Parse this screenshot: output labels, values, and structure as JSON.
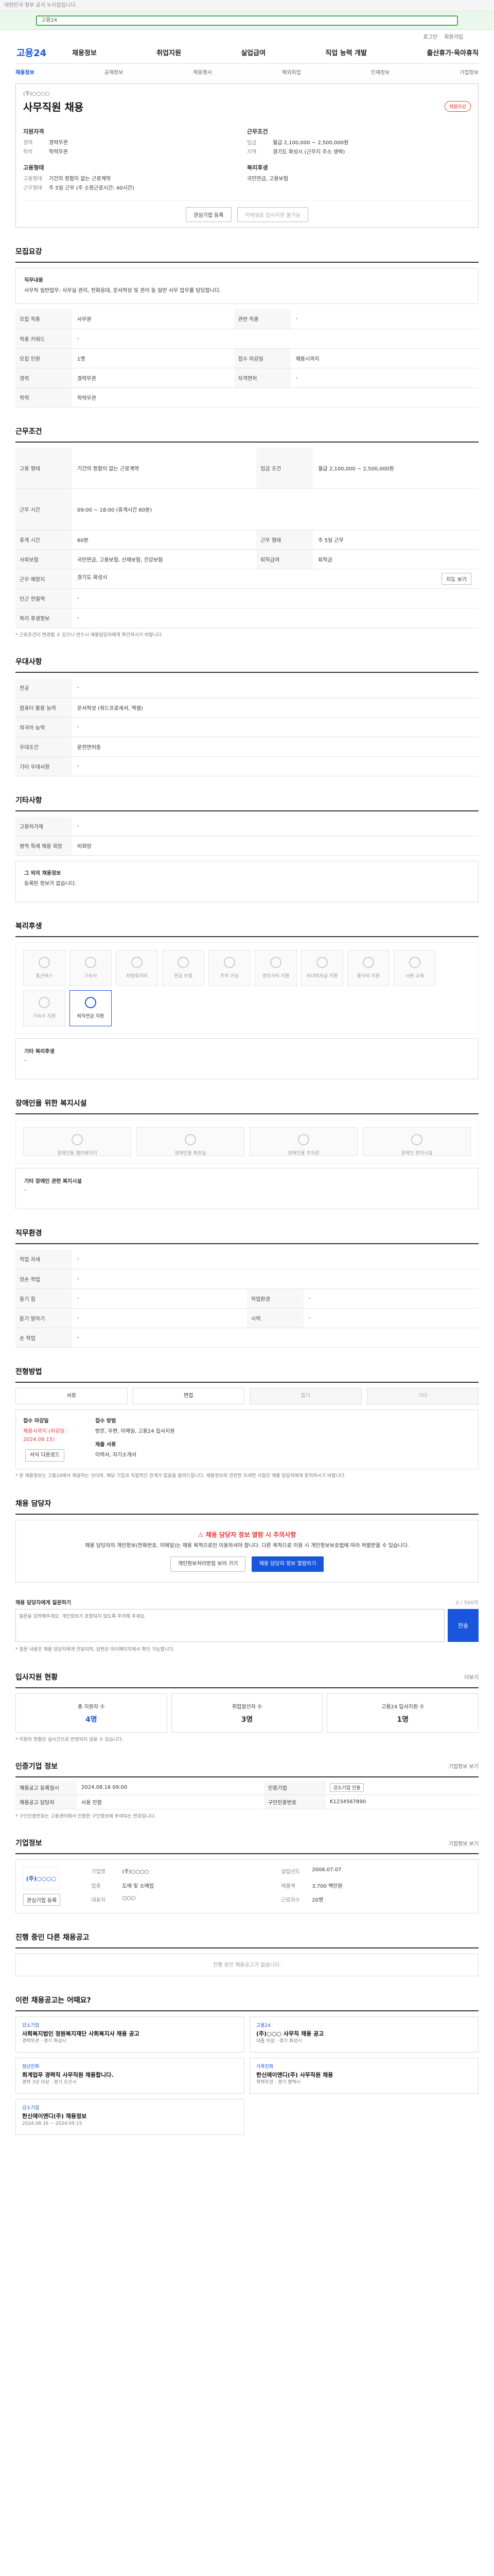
{
  "topbar": {
    "text": "대한민국 정부 공식 누리집입니다."
  },
  "search": {
    "value": "고용24"
  },
  "util": [
    "로그인",
    "회원가입"
  ],
  "gnb": {
    "logo": "고용24",
    "menu": [
      "채용정보",
      "취업지원",
      "실업급여",
      "직업 능력 개발",
      "출산휴가·육아휴직"
    ]
  },
  "snb": [
    "채용정보",
    "공채정보",
    "채용행사",
    "해외취업",
    "인재정보",
    "기업정보"
  ],
  "job": {
    "company": "(주)○○○○",
    "title": "사무직원 채용",
    "badge": "채용마감",
    "left_head": "지원자격",
    "left": [
      {
        "k": "경력",
        "v": "경력무관"
      },
      {
        "k": "학력",
        "v": "학력무관"
      }
    ],
    "left_head2": "고용형태",
    "left2": [
      {
        "k": "고용형태",
        "v": "기간의 정함이 없는 근로계약"
      },
      {
        "k": "근무형태",
        "v": "주 5일 근무 (주 소정근로시간: 40시간)"
      }
    ],
    "right_head": "근무조건",
    "right": [
      {
        "k": "임금",
        "v": "월급 2,100,000 ~ 2,500,000원"
      },
      {
        "k": "지역",
        "v": "경기도 화성시 (근무지 주소 생략)"
      }
    ],
    "right_head2": "복리후생",
    "right2": [
      {
        "k": "",
        "v": "국민연금, 고용보험"
      }
    ],
    "btn1": "관심기업 등록",
    "btn2": "이메일로 입사지원 불가능"
  },
  "s1": {
    "title": "모집요강",
    "content_label": "직무내용",
    "content": "사무직 일반업무: 사무실 관리, 전화응대, 문서작성 및 관리 등 일반 사무 업무를 담당합니다.",
    "rows": [
      {
        "k": "모집 직종",
        "v": "사무원",
        "k2": "관련 직종",
        "v2": "-"
      },
      {
        "k": "직종 키워드",
        "v": "-",
        "k2": "",
        "v2": ""
      },
      {
        "k": "모집 인원",
        "v": "1명",
        "k2": "접수 마감일",
        "v2": "채용시까지"
      },
      {
        "k": "경력",
        "v": "경력무관",
        "k2": "자격면허",
        "v2": "-"
      },
      {
        "k": "학력",
        "v": "학력무관",
        "k2": "",
        "v2": ""
      }
    ]
  },
  "s2": {
    "title": "근무조건",
    "rows": [
      {
        "k": "고용 형태",
        "v": "기간의 정함이 없는 근로계약",
        "k2": "임금 조건",
        "v2": "월급 2,100,000 ~ 2,500,000원"
      },
      {
        "k": "근무 시간",
        "v": "09:00 ~ 18:00 (휴게시간 60분)",
        "k2": "",
        "v2": ""
      },
      {
        "k": "휴게 시간",
        "v": "60분",
        "k2": "근무 형태",
        "v2": "주 5일 근무"
      },
      {
        "k": "사회보험",
        "v": "국민연금, 고용보험, 산재보험, 건강보험",
        "k2": "퇴직급여",
        "v2": "퇴직금"
      },
      {
        "k": "근무 예정지",
        "v": "경기도 화성시",
        "k2": "",
        "v2": ""
      },
      {
        "k": "인근 전철역",
        "v": "-",
        "k2": "",
        "v2": ""
      },
      {
        "k": "복리 후생정보",
        "v": "-",
        "k2": "",
        "v2": ""
      }
    ],
    "map_btn": "지도 보기",
    "note": "* 근로조건이 변경될 수 있으니 반드시 채용담당자에게 확인하시기 바랍니다."
  },
  "s3": {
    "title": "우대사항",
    "rows": [
      {
        "k": "전공",
        "v": "-"
      },
      {
        "k": "컴퓨터 활용 능력",
        "v": "문서작성 (워드프로세서, 엑셀)"
      },
      {
        "k": "외국어 능력",
        "v": "-"
      },
      {
        "k": "우대조건",
        "v": "운전면허증"
      },
      {
        "k": "기타 우대사항",
        "v": "-"
      }
    ]
  },
  "s4": {
    "title": "기타사항",
    "rows": [
      {
        "k": "고용허가제",
        "v": "-"
      },
      {
        "k": "병역 특례 채용 희망",
        "v": "비희망"
      }
    ],
    "extra_label": "그 외의 채용정보",
    "extra": "등록된 정보가 없습니다."
  },
  "s5": {
    "title": "복리후생",
    "items": [
      {
        "label": "통근버스",
        "on": false
      },
      {
        "label": "기숙사",
        "on": false
      },
      {
        "label": "차량유지비",
        "on": false
      },
      {
        "label": "연금 보험",
        "on": false
      },
      {
        "label": "주차 가능",
        "on": false
      },
      {
        "label": "경조사비 지원",
        "on": false
      },
      {
        "label": "자녀학자금 지원",
        "on": false
      },
      {
        "label": "중식비 지원",
        "on": false
      },
      {
        "label": "사원 교육",
        "on": false
      },
      {
        "label": "기숙사 지원",
        "on": false
      },
      {
        "label": "퇴직연금 지원",
        "on": true
      }
    ],
    "other_label": "기타 복리후생",
    "other": "-"
  },
  "s6": {
    "title": "장애인을 위한 복지시설",
    "items": [
      "장애인용 엘리베이터",
      "장애인용 화장실",
      "장애인용 주차장",
      "장애인 편의시설"
    ],
    "other_label": "기타 장애인 관련 복지시설",
    "other": "-"
  },
  "s7": {
    "title": "직무환경",
    "rows": [
      {
        "k": "작업 자세",
        "v": "-",
        "k2": "",
        "v2": ""
      },
      {
        "k": "양손 작업",
        "v": "-",
        "k2": "",
        "v2": ""
      },
      {
        "k": "들기 힘",
        "v": "-",
        "k2": "작업환경",
        "v2": "-"
      },
      {
        "k": "듣기 말하기",
        "v": "-",
        "k2": "시력",
        "v2": "-"
      },
      {
        "k": "손 작업",
        "v": "-",
        "k2": "",
        "v2": ""
      }
    ]
  },
  "s8": {
    "title": "전형방법",
    "steps": [
      {
        "label": "서류",
        "dim": false
      },
      {
        "label": "면접",
        "dim": false
      },
      {
        "label": "필기",
        "dim": true
      },
      {
        "label": "기타",
        "dim": true
      }
    ],
    "apply_label": "접수 마감일",
    "apply": "채용시까지 (마감일 : 2024.09.15)",
    "method_label": "접수 방법",
    "method": "방문, 우편, 이메일, 고용24 입사지원",
    "doc_label": "제출 서류",
    "doc": "이력서, 자기소개서",
    "form_btn": "서식 다운로드",
    "notes": "* 본 채용정보는 고용24에서 제공하는 것이며, 해당 기업과 직접적인 관계가 없음을 알려드립니다. 채용정보와 관련한 자세한 사항은 채용 담당자에게 문의하시기 바랍니다."
  },
  "s9": {
    "title": "채용 담당자",
    "alert": "채용 담당자 정보 열람 시 주의사항",
    "body": "채용 담당자의 개인정보(전화번호, 이메일)는 채용 목적으로만 이용하셔야 합니다. 다른 목적으로 이용 시 개인정보보호법에 따라 처벌받을 수 있습니다.",
    "btn1": "개인정보처리방침 보러 가기",
    "btn2": "채용 담당자 정보 열람하기"
  },
  "qa": {
    "label": "채용 담당자에게 질문하기",
    "count": "0 / 500자",
    "placeholder": "질문을 입력해주세요. 개인정보가 포함되지 않도록 주의해 주세요.",
    "send": "전송",
    "notes": "* 질문 내용은 채용 담당자에게 전달되며, 답변은 마이페이지에서 확인 가능합니다."
  },
  "s10": {
    "title": "입사지원 현황",
    "more": "더보기",
    "items": [
      {
        "label": "총 지원자 수",
        "num": "4명"
      },
      {
        "label": "취업알선자 수",
        "num": "3명"
      },
      {
        "label": "고용24 입사지원 수",
        "num": "1명"
      }
    ],
    "note": "* 지원자 현황은 실시간으로 반영되지 않을 수 있습니다."
  },
  "s11": {
    "title": "인증기업 정보",
    "more": "기업정보 보기",
    "rows": [
      {
        "k": "채용공고 등록일시",
        "v": "2024.08.16 09:00",
        "k2": "인증기업",
        "v2": "강소기업 인증"
      },
      {
        "k": "채용공고 담당자",
        "v": "사용 안함",
        "k2": "구인인증번호",
        "v2": "K1234567890"
      }
    ],
    "note": "* 구인인증번호는 고용센터에서 인증한 구인정보에 부여되는 번호입니다."
  },
  "s12": {
    "title": "기업정보",
    "more": "기업정보 보기",
    "logo": "(주)○○○○",
    "grid": [
      [
        "기업명",
        "(주)○○○○",
        "설립년도",
        "2006.07.07"
      ],
      [
        "업종",
        "도매 및 소매업",
        "매출액",
        "3,700 백만원"
      ],
      [
        "대표자",
        "○○○",
        "근로자수",
        "20명"
      ]
    ],
    "btn": "관심기업 등록"
  },
  "s13": {
    "title": "진행 중인 다른 채용공고",
    "empty": "진행 중인 채용공고가 없습니다."
  },
  "s14": {
    "title": "이런 채용공고는 어때요?",
    "items": [
      {
        "tag": "강소기업",
        "title": "사회복지법인 정원복지재단 사회복지사 채용 공고",
        "meta": "경력무관 · 경기 화성시"
      },
      {
        "tag": "고용24",
        "title": "(주)○○○ 사무직 채용 공고",
        "meta": "대졸 이상 · 경기 화성시"
      },
      {
        "tag": "청년친화",
        "title": "회계업무 경력직 사무직원 채용합니다.",
        "meta": "경력 3년 이상 · 경기 오산시"
      },
      {
        "tag": "가족친화",
        "title": "한신에이앤디(주) 사무직원 채용",
        "meta": "학력무관 · 경기 평택시"
      },
      {
        "tag": "강소기업",
        "title": "한신에이앤디(주) 채용정보",
        "meta": "2024.08.16 ~ 2024.09.15"
      }
    ]
  }
}
